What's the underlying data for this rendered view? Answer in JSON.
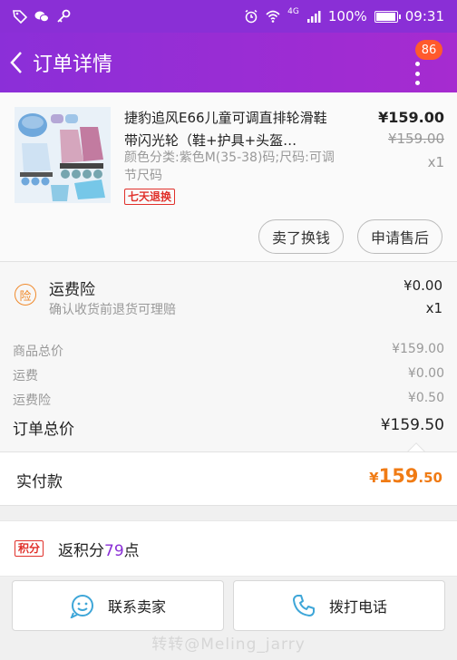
{
  "status_bar": {
    "network": "4G",
    "battery": "100%",
    "battery_fraction": 1.0,
    "time": "09:31"
  },
  "header": {
    "title": "订单详情",
    "badge_count": "86"
  },
  "product": {
    "name": "捷豹追风E66儿童可调直排轮滑鞋 带闪光轮（鞋+护具+头盔…",
    "spec": "颜色分类:紫色M(35-38)码;尺码:可调节尺码",
    "return_tag": "七天退换",
    "price": "¥159.00",
    "original_price": "¥159.00",
    "quantity": "x1",
    "sell_button": "卖了换钱",
    "after_sale_button": "申请售后"
  },
  "insurance": {
    "icon_text": "险",
    "title": "运费险",
    "desc": "确认收货前退货可理赔",
    "price": "¥0.00",
    "quantity": "x1"
  },
  "summary": {
    "rows": [
      {
        "label": "商品总价",
        "value": "¥159.00"
      },
      {
        "label": "运费",
        "value": "¥0.00"
      },
      {
        "label": "运费险",
        "value": "¥0.50"
      }
    ],
    "total_label": "订单总价",
    "total_value": "¥159.50"
  },
  "payment": {
    "label": "实付款",
    "currency": "¥",
    "amount_int": "159",
    "amount_dec": ".50",
    "color": "#f07b14"
  },
  "points": {
    "tag": "积分",
    "prefix": "返积分",
    "value": "79",
    "suffix": "点"
  },
  "actions": {
    "contact_seller": "联系卖家",
    "call_phone": "拨打电话"
  },
  "watermark": "转转@Meling_jarry",
  "colors": {
    "brand": "#8a2fd6",
    "badge": "#ff5a2c",
    "accent_red": "#e0302a"
  }
}
